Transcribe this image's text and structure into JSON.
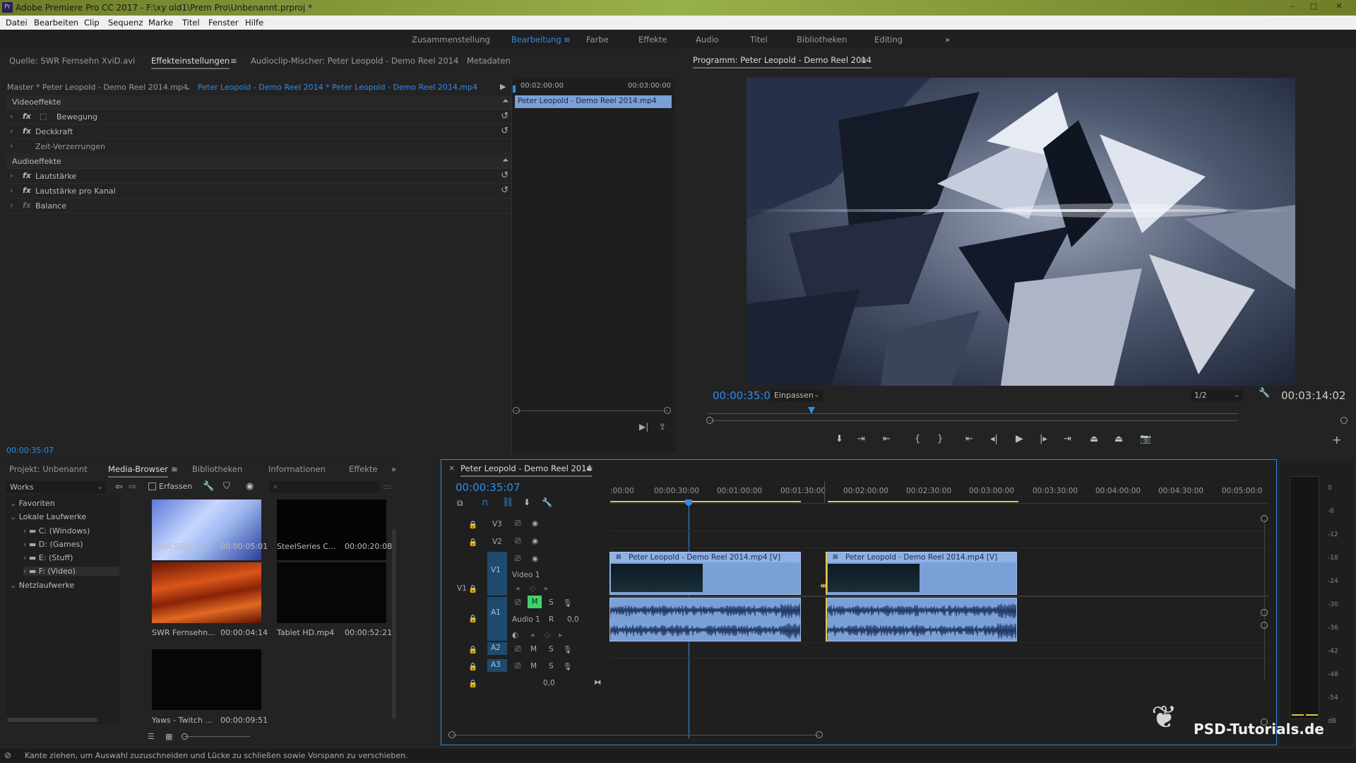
{
  "app": {
    "logo": "Pr",
    "title": "Adobe Premiere Pro CC 2017 - F:\\xy old1\\Prem Pro\\Unbenannt.prproj *",
    "win_controls": [
      "–",
      "□",
      "✕"
    ]
  },
  "menu": [
    "Datei",
    "Bearbeiten",
    "Clip",
    "Sequenz",
    "Marke",
    "Titel",
    "Fenster",
    "Hilfe"
  ],
  "workspaces": {
    "items": [
      "Zusammenstellung",
      "Bearbeitung",
      "Farbe",
      "Effekte",
      "Audio",
      "Titel",
      "Bibliotheken",
      "Editing"
    ],
    "active": "Bearbeitung",
    "more": "»",
    "menu_icon": "≡"
  },
  "source_panel": {
    "tabs": [
      "Quelle: SWR Fernsehn XviD.avi",
      "Effekteinstellungen",
      "Audioclip-Mischer: Peter Leopold - Demo Reel 2014",
      "Metadaten"
    ],
    "active_tab": "Effekteinstellungen",
    "master_label": "Master * Peter Leopold - Demo Reel 2014.mp4",
    "sequence_label": "Peter Leopold - Demo Reel 2014 * Peter Leopold - Demo Reel 2014.mp4",
    "video_section": "Videoeffekte",
    "video_effects": [
      "Bewegung",
      "Deckkraft",
      "Zeit-Verzerrungen"
    ],
    "audio_section": "Audioeffekte",
    "audio_effects": [
      "Lautstärke",
      "Lautstärke pro Kanal",
      "Balance"
    ],
    "fx_label": "fx",
    "ruler": [
      "00:02:00:00",
      "00:03:00:00"
    ],
    "mini_clip": "Peter Leopold - Demo Reel 2014.mp4",
    "timecode": "00:00:35:07"
  },
  "program_monitor": {
    "title": "Programm: Peter Leopold - Demo Reel 2014",
    "timecode": "00:00:35:07",
    "fit": "Einpassen",
    "resolution": "1/2",
    "duration": "00:03:14:02"
  },
  "project_panel": {
    "tabs": [
      "Projekt: Unbenannt",
      "Media-Browser",
      "Bibliotheken",
      "Informationen",
      "Effekte"
    ],
    "active_tab": "Media-Browser",
    "dropdown": "Works",
    "capture_label": "Erfassen",
    "tree": {
      "favorites": "Favoriten",
      "local": "Lokale Laufwerke",
      "drives": [
        "C: (Windows)",
        "D: (Games)",
        "E: (Stuff)",
        "F: (Video)"
      ],
      "network": "Netzlaufwerke"
    },
    "media": [
      {
        "name": "SinoCSGO_YT_...",
        "duration": "00:00:05:01"
      },
      {
        "name": "SteelSeries C...",
        "duration": "00:00:20:08"
      },
      {
        "name": "SWR Fernsehn...",
        "duration": "00:00:04:14"
      },
      {
        "name": "Tablet HD.mp4",
        "duration": "00:00:52:21"
      },
      {
        "name": "Yaws - Twitch ...",
        "duration": "00:00:09:51"
      }
    ]
  },
  "timeline": {
    "sequence": "Peter Leopold - Demo Reel 2014",
    "timecode": "00:00:35:07",
    "ruler": [
      ":00:00",
      "00:00:30:00",
      "00:01:00:00",
      "00:01:30:00",
      "00:02:00:00",
      "00:02:30:00",
      "00:03:00:00",
      "00:03:30:00",
      "00:04:00:00",
      "00:04:30:00",
      "00:05:00:0"
    ],
    "tracks": {
      "video": [
        "V3",
        "V2",
        "V1"
      ],
      "audio": [
        "A1",
        "A2",
        "A3"
      ],
      "video1_name": "Video 1",
      "audio1_name": "Audio 1",
      "audio1_value": "0,0",
      "master_value": "0,0",
      "source_v": "V1",
      "source_a": "A1"
    },
    "clips": {
      "video_label": "Peter Leopold - Demo Reel 2014.mp4 [V]",
      "track_letters": {
        "mute": "M",
        "solo": "S",
        "record": "R"
      }
    }
  },
  "meter": {
    "scale": [
      "0",
      "-6",
      "-12",
      "-18",
      "-24",
      "-30",
      "-36",
      "-42",
      "-48",
      "-54",
      "dB"
    ],
    "solo": [
      "S",
      "S"
    ]
  },
  "watermark": "PSD-Tutorials.de",
  "status": "Kante ziehen, um Auswahl zuzuschneiden und Lücke zu schließen sowie Vorspann zu verschieben."
}
